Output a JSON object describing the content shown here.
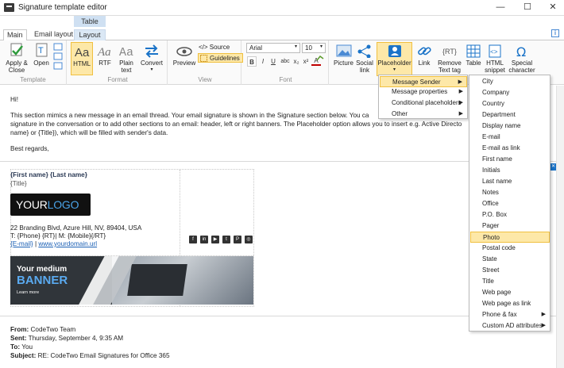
{
  "window": {
    "title": "Signature template editor",
    "context_tab_group": "Table",
    "controls": {
      "minimize": "—",
      "maximize": "☐",
      "close": "✕"
    }
  },
  "tabs": [
    {
      "label": "Main",
      "active": true
    },
    {
      "label": "Email layout",
      "active": false
    },
    {
      "label": "Layout",
      "active": false
    }
  ],
  "ribbon": {
    "template": {
      "label": "Template",
      "apply_close": "Apply &\nClose",
      "open": "Open"
    },
    "format": {
      "label": "Format",
      "html": "HTML",
      "rtf": "RTF",
      "plain": "Plain\ntext",
      "convert": "Convert"
    },
    "view": {
      "label": "View",
      "preview": "Preview",
      "source": "</> Source",
      "guidelines": "Guidelines"
    },
    "font": {
      "label": "Font",
      "family": "Arial",
      "size": "10",
      "bold": "B",
      "italic": "I",
      "underline": "U",
      "abc": "abc",
      "sub": "x₂",
      "sup": "x²",
      "color": "A"
    },
    "insert": {
      "picture": "Picture",
      "social": "Social\nlink",
      "placeholder": "Placeholder",
      "link": "Link",
      "remove": "Remove\nText tag",
      "table": "Table",
      "html_snippet": "HTML\nsnippet",
      "special": "Special\ncharacter"
    }
  },
  "message": {
    "greeting": "Hi!",
    "body1": "This section mimics a new message in an email thread. Your email signature is shown in the Signature section below. You ca",
    "body2": "signature in the conversation or to add other sections to an email: header, left or right banners. The Placeholder option allows you to insert e.g. Active Directo",
    "body3": "name} or {Title}), which will be filled with sender's data.",
    "regards": "Best regards,"
  },
  "signature": {
    "name": "{First name} {Last name}",
    "title": "{Title}",
    "logo_your": "YOUR",
    "logo_logo": "LOGO",
    "address": "22 Branding Blvd, Azure Hill, NV, 89404, USA",
    "phones": "T: {Phone} {RT}| M: {Mobile}{/RT}",
    "email": "{E-mail}",
    "pipe": " | ",
    "url": "www.yourdomain.url",
    "social_icons": [
      "facebook-icon",
      "linkedin-icon",
      "youtube-icon",
      "twitter-icon",
      "pinterest-icon",
      "instagram-icon"
    ],
    "social_glyphs": [
      "f",
      "in",
      "▶",
      "t",
      "P",
      "◎"
    ],
    "banner_line1": "Your medium",
    "banner_line2": "BANNER",
    "banner_line3": "Learn more"
  },
  "quoted": {
    "from_label": "From:",
    "from": " CodeTwo Team",
    "sent_label": "Sent:",
    "sent": " Thursday, September 4, 9:35 AM",
    "to_label": "To:",
    "to": " You",
    "subject_label": "Subject:",
    "subject": " RE: CodeTwo Email Signatures for Office 365"
  },
  "placeholder_menu": [
    "Message Sender",
    "Message properties",
    "Conditional placeholders",
    "Other"
  ],
  "sender_submenu": [
    "City",
    "Company",
    "Country",
    "Department",
    "Display name",
    "E-mail",
    "E-mail as link",
    "First name",
    "Initials",
    "Last name",
    "Notes",
    "Office",
    "P.O. Box",
    "Pager",
    "Photo",
    "Postal code",
    "State",
    "Street",
    "Title",
    "Web page",
    "Web page as link",
    "Phone & fax",
    "Custom AD attributes"
  ],
  "colors": {
    "accent": "#1a73c8",
    "highlight": "#fde8a8",
    "link": "#1a5fb4"
  }
}
